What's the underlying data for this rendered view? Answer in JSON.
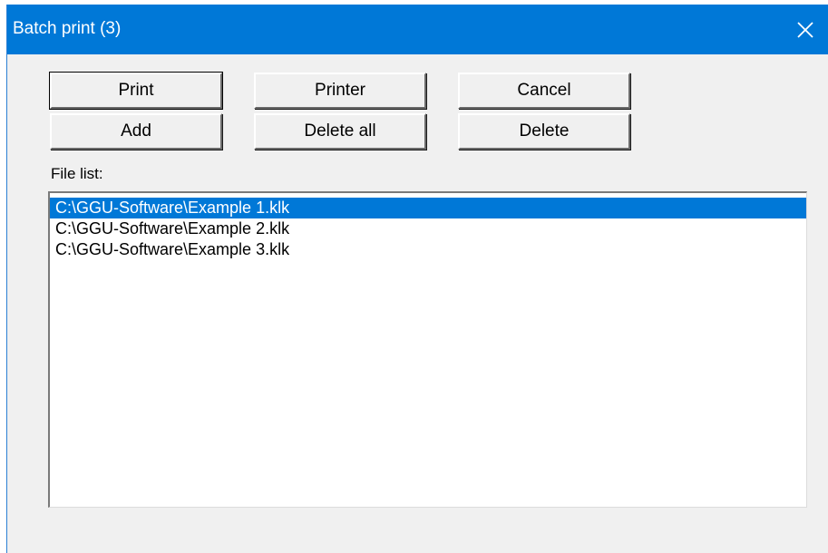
{
  "window": {
    "title": "Batch print (3)",
    "accent_color": "#0078d7",
    "close_icon": "close-icon"
  },
  "buttons": {
    "print": "Print",
    "printer": "Printer",
    "cancel": "Cancel",
    "add": "Add",
    "delete_all": "Delete all",
    "delete": "Delete"
  },
  "file_list": {
    "label": "File list:",
    "selected_index": 0,
    "items": [
      "C:\\GGU-Software\\Example 1.klk",
      "C:\\GGU-Software\\Example 2.klk",
      "C:\\GGU-Software\\Example 3.klk"
    ]
  }
}
